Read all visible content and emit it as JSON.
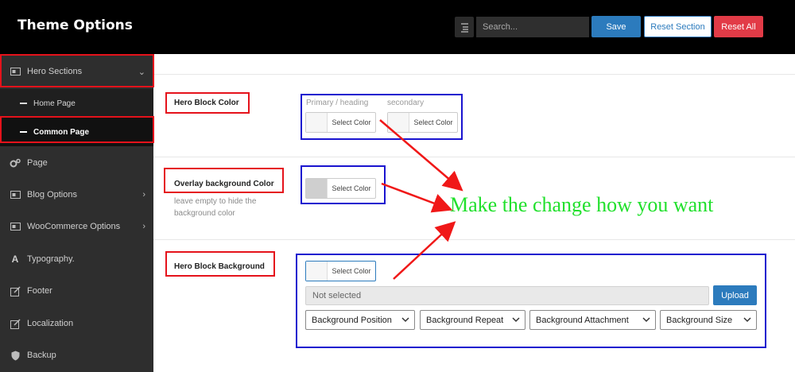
{
  "header": {
    "title": "Theme Options",
    "search_placeholder": "Search...",
    "save_label": "Save",
    "reset_section_label": "Reset Section",
    "reset_all_label": "Reset All"
  },
  "sidebar": {
    "items": [
      {
        "label": "Hero Sections",
        "icon": "panel-icon"
      },
      {
        "label": "Home Page"
      },
      {
        "label": "Common Page"
      },
      {
        "label": "Page",
        "icon": "gears-icon"
      },
      {
        "label": "Blog Options",
        "icon": "panel-icon"
      },
      {
        "label": "WooCommerce Options",
        "icon": "panel-icon"
      },
      {
        "label": "Typography.",
        "icon": "font-icon"
      },
      {
        "label": "Footer",
        "icon": "edit-icon"
      },
      {
        "label": "Localization",
        "icon": "edit-icon"
      },
      {
        "label": "Backup",
        "icon": "shield-icon"
      }
    ]
  },
  "fields": {
    "hero_block_color": {
      "label": "Hero Block Color",
      "primary_label": "Primary / heading",
      "secondary_label": "secondary",
      "select_color": "Select Color"
    },
    "overlay": {
      "label": "Overlay background Color",
      "description": "leave empty to hide the background color",
      "select_color": "Select Color"
    },
    "hero_block_background": {
      "label": "Hero Block Background",
      "select_color": "Select Color",
      "file_value": "Not selected",
      "upload_label": "Upload",
      "selects": [
        "Background Position",
        "Background Repeat",
        "Background Attachment",
        "Background Size"
      ]
    }
  },
  "annotation": {
    "text": "Make the change how you want",
    "text_color": "#21e02c",
    "red": "#e5121b",
    "blue": "#1a14cf"
  },
  "colors": {
    "accent": "#2c7bbd",
    "danger": "#e23b47",
    "header_bg": "#000000",
    "sidebar_bg": "#2e2e2e"
  }
}
